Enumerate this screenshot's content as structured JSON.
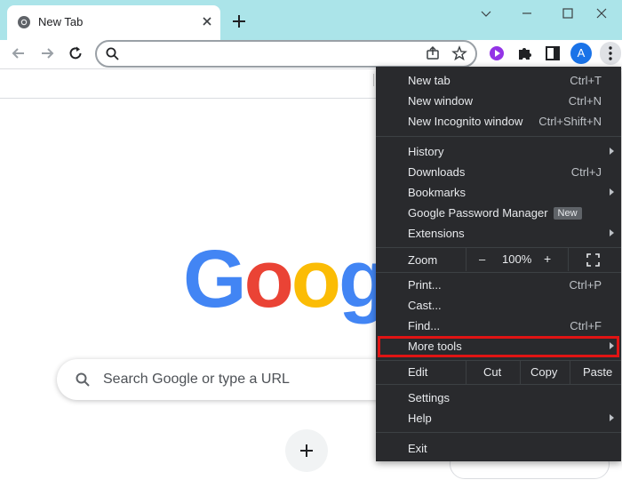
{
  "browser": {
    "tab_title": "New Tab",
    "account_initial": "A"
  },
  "omnibox": {
    "value": ""
  },
  "ntp": {
    "logo_letters": [
      "G",
      "o",
      "o",
      "g"
    ],
    "logo_colors": [
      "#4285f4",
      "#ea4335",
      "#fbbc05",
      "#4285f4"
    ],
    "search_placeholder": "Search Google or type a URL"
  },
  "menu": {
    "new_tab": {
      "label": "New tab",
      "shortcut": "Ctrl+T"
    },
    "new_window": {
      "label": "New window",
      "shortcut": "Ctrl+N"
    },
    "new_incognito": {
      "label": "New Incognito window",
      "shortcut": "Ctrl+Shift+N"
    },
    "history": {
      "label": "History"
    },
    "downloads": {
      "label": "Downloads",
      "shortcut": "Ctrl+J"
    },
    "bookmarks": {
      "label": "Bookmarks"
    },
    "password_manager": {
      "label": "Google Password Manager",
      "badge": "New"
    },
    "extensions": {
      "label": "Extensions"
    },
    "zoom": {
      "label": "Zoom",
      "minus": "–",
      "level": "100%",
      "plus": "+"
    },
    "print": {
      "label": "Print...",
      "shortcut": "Ctrl+P"
    },
    "cast": {
      "label": "Cast..."
    },
    "find": {
      "label": "Find...",
      "shortcut": "Ctrl+F"
    },
    "more_tools": {
      "label": "More tools"
    },
    "edit": {
      "label": "Edit",
      "cut": "Cut",
      "copy": "Copy",
      "paste": "Paste"
    },
    "settings": {
      "label": "Settings"
    },
    "help": {
      "label": "Help"
    },
    "exit": {
      "label": "Exit"
    }
  },
  "colors": {
    "titlebar": "#abe4e9",
    "menu_bg": "#292a2d",
    "highlight_border": "#e01414",
    "accent_blue": "#1a73e8"
  },
  "icons": [
    "chrome-favicon-icon",
    "close-icon",
    "plus-icon",
    "minimize-icon",
    "maximize-icon",
    "close-window-icon",
    "back-icon",
    "forward-icon",
    "reload-icon",
    "search-icon",
    "share-icon",
    "star-icon",
    "extension-purple-icon",
    "puzzle-icon",
    "side-panel-icon",
    "kebab-menu-icon",
    "fullscreen-icon",
    "submenu-arrow-icon"
  ]
}
